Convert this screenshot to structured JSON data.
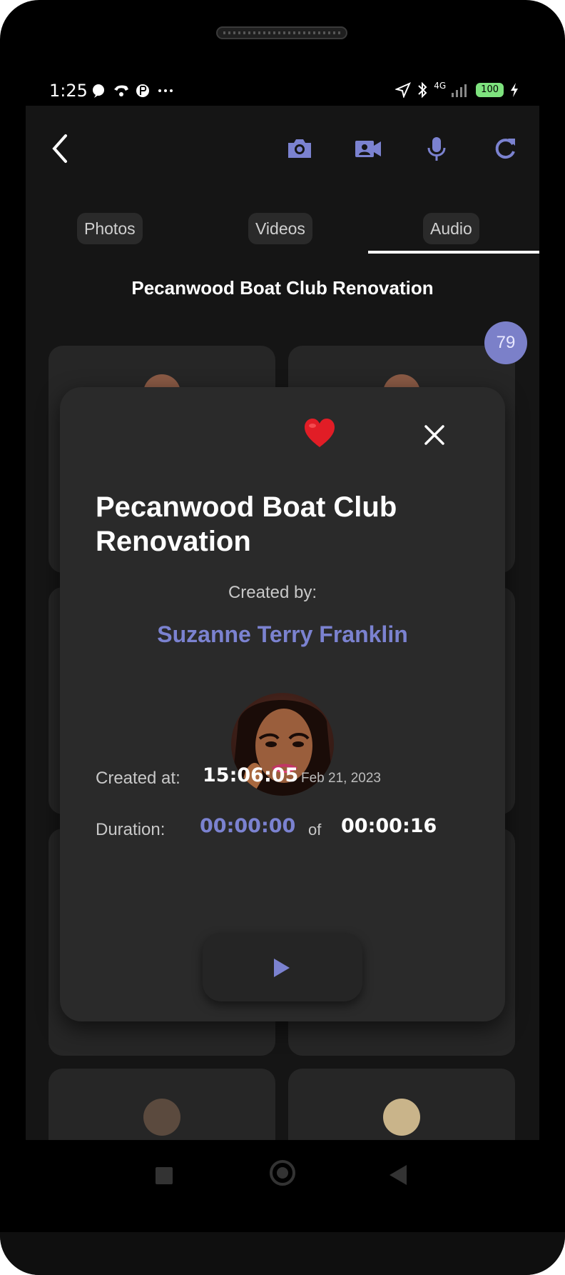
{
  "status_bar": {
    "time": "1:25",
    "battery": "100",
    "network": "4G"
  },
  "toolbar": {
    "icons": [
      "back-icon",
      "camera-icon",
      "video-camera-icon",
      "microphone-icon",
      "refresh-icon"
    ],
    "accent_color": "#7b82d0"
  },
  "tabs": [
    {
      "label": "Photos",
      "selected": false
    },
    {
      "label": "Videos",
      "selected": false
    },
    {
      "label": "Audio",
      "selected": true
    }
  ],
  "page_title": "Pecanwood Boat Club Renovation",
  "item_count": "79",
  "modal": {
    "title": "Pecanwood Boat Club Renovation",
    "created_by_label": "Created by:",
    "creator_name": "Suzanne Terry Franklin",
    "created_at_label": "Created at:",
    "created_time": "15:06:05",
    "created_date": "Feb 21, 2023",
    "duration_label": "Duration:",
    "duration_current": "00:00:00",
    "of_label": "of",
    "duration_total": "00:00:16",
    "favorite_icon": "heart-icon",
    "close_icon": "close-icon",
    "play_icon": "play-icon"
  },
  "colors": {
    "background": "#151515",
    "card": "#262626",
    "modal": "#2a2a2a",
    "accent": "#7b82d0",
    "badge": "#7b80c9"
  }
}
